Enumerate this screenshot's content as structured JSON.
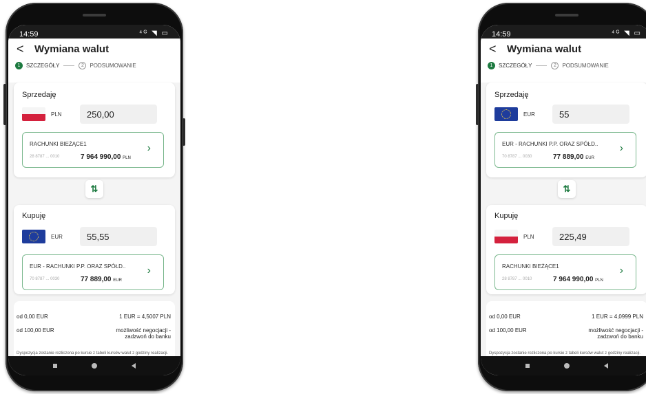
{
  "phones": [
    {
      "status": {
        "time": "14:59",
        "icons": "⁴ᴳ ◥ ▭"
      },
      "header": {
        "back": "<",
        "title": "Wymiana walut"
      },
      "steps": [
        {
          "num": "1",
          "label": "SZCZEGÓŁY"
        },
        {
          "num": "2",
          "label": "PODSUMOWANIE"
        }
      ],
      "sell": {
        "title": "Sprzedaję",
        "currency": "PLN",
        "amount": "250,00",
        "account": {
          "name": "RACHUNKI BIEŻĄCE1",
          "number": "28 8787 ... 0010",
          "balance": "7 964 990,00",
          "balance_currency": "PLN"
        }
      },
      "swap_icon": "⇅",
      "buy": {
        "title": "Kupuję",
        "currency": "EUR",
        "amount": "55,55",
        "account": {
          "name": "EUR - RACHUNKI P.P. ORAZ SPÓŁD..",
          "number": "70 8787 ... 0030",
          "balance": "77 889,00",
          "balance_currency": "EUR"
        }
      },
      "rates": [
        {
          "left": "od 0,00 EUR",
          "right": "1 EUR = 4,5007 PLN"
        },
        {
          "left": "od 100,00 EUR",
          "right": "możliwość negocjacji - zadzwoń do banku"
        }
      ],
      "disclaimer": "Dyspozycja zostanie rozliczona po kursie z tabeli kursów walut z godziny realizacji."
    },
    {
      "status": {
        "time": "14:59",
        "icons": "⁴ᴳ ◥ ▭"
      },
      "header": {
        "back": "<",
        "title": "Wymiana walut"
      },
      "steps": [
        {
          "num": "1",
          "label": "SZCZEGÓŁY"
        },
        {
          "num": "2",
          "label": "PODSUMOWANIE"
        }
      ],
      "sell": {
        "title": "Sprzedaję",
        "currency": "EUR",
        "amount": "55",
        "account": {
          "name": "EUR - RACHUNKI P.P. ORAZ SPÓŁD..",
          "number": "70 8787 ... 0030",
          "balance": "77 889,00",
          "balance_currency": "EUR"
        }
      },
      "swap_icon": "⇅",
      "buy": {
        "title": "Kupuję",
        "currency": "PLN",
        "amount": "225,49",
        "account": {
          "name": "RACHUNKI BIEŻĄCE1",
          "number": "28 8787 ... 0010",
          "balance": "7 964 990,00",
          "balance_currency": "PLN"
        }
      },
      "rates": [
        {
          "left": "od 0,00 EUR",
          "right": "1 EUR = 4,0999 PLN"
        },
        {
          "left": "od 100,00 EUR",
          "right": "możliwość negocjacji - zadzwoń do banku"
        }
      ],
      "disclaimer": "Dyspozycja zostanie rozliczona po kursie z tabeli kursów walut z godziny realizacji."
    }
  ],
  "colors": {
    "accent": "#1d7a40",
    "account_border": "#7bb88e",
    "pl_red": "#d4213d",
    "eu_blue": "#1e3c9c"
  }
}
